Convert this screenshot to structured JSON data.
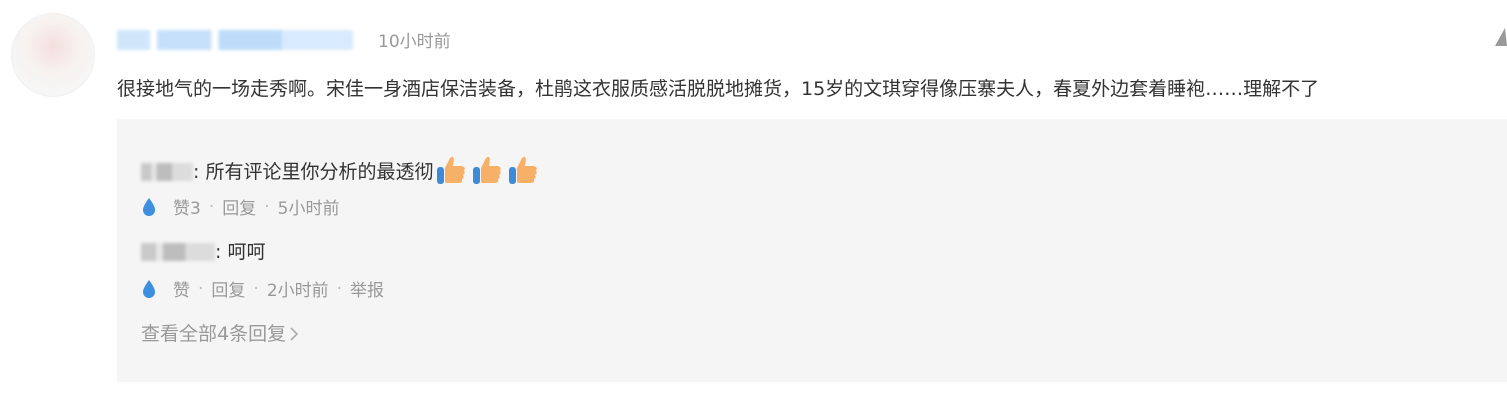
{
  "comment": {
    "time": "10小时前",
    "text": "很接地气的一场走秀啊。宋佳一身酒店保洁装备，杜鹃这衣服质感活脱脱地摊货，15岁的文琪穿得像压寨夫人，春夏外边套着睡袍……理解不了"
  },
  "replies": [
    {
      "name_blurred": true,
      "separator": ":",
      "text": "所有评论里你分析的最透彻",
      "emoji": [
        "thumbs-up",
        "thumbs-up",
        "thumbs-up"
      ],
      "likes_label": "赞3",
      "reply_label": "回复",
      "time": "5小时前"
    },
    {
      "name_blurred": true,
      "separator": ":",
      "text": "呵呵",
      "likes_label": "赞",
      "reply_label": "回复",
      "time": "2小时前",
      "report_label": "举报"
    }
  ],
  "view_all_label": "查看全部4条回复",
  "colors": {
    "text": "#333333",
    "muted": "#999999",
    "reply_bg": "#f5f5f5",
    "drop_icon": "#3d8fe0",
    "thumb_fill": "#f7b068",
    "thumb_cuff": "#3e8ad6"
  }
}
